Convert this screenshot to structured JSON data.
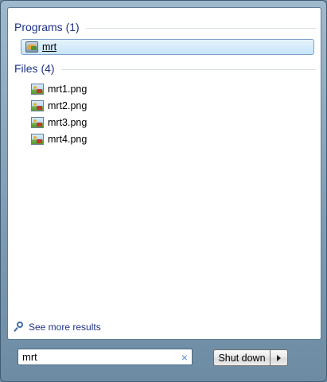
{
  "programs": {
    "header": "Programs (1)",
    "items": [
      {
        "label": "mrt",
        "icon": "application-icon"
      }
    ]
  },
  "files": {
    "header": "Files (4)",
    "items": [
      {
        "label": "mrt1.png",
        "icon": "image-file-icon"
      },
      {
        "label": "mrt2.png",
        "icon": "image-file-icon"
      },
      {
        "label": "mrt3.png",
        "icon": "image-file-icon"
      },
      {
        "label": "mrt4.png",
        "icon": "image-file-icon"
      }
    ]
  },
  "see_more": {
    "label": "See more results",
    "icon": "magnifier-icon"
  },
  "search": {
    "value": "mrt",
    "clear_glyph": "×"
  },
  "shutdown": {
    "label": "Shut down",
    "arrow_icon": "arrow-right-icon"
  },
  "colors": {
    "group_header": "#1e3287",
    "selection_border": "#7da2ce",
    "frame": "#7c9bb3"
  }
}
